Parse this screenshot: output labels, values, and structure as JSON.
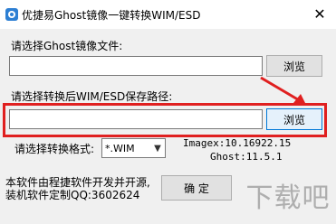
{
  "window": {
    "title": "优捷易Ghost镜像一键转换WIM/ESD",
    "close_glyph": "✕"
  },
  "source": {
    "label": "请选择Ghost镜像文件:",
    "value": "",
    "browse_label": "浏览"
  },
  "output": {
    "label": "请选择转换后WIM/ESD保存路径:",
    "value": "",
    "browse_label": "浏览"
  },
  "format": {
    "label": "请选择转换格式:",
    "selected": "*.WIM"
  },
  "image_info": {
    "imagex": "Imagex:10.16922.15",
    "ghost": "Ghost:11.5.1"
  },
  "footer": {
    "line1": "本软件由程捷软件开发并开源,",
    "line2": "装机软件定制QQ:3602624"
  },
  "ok_button_label": "确  定",
  "watermark": "下载吧",
  "colors": {
    "highlight": "#e02020",
    "focus_border": "#0078d7"
  }
}
